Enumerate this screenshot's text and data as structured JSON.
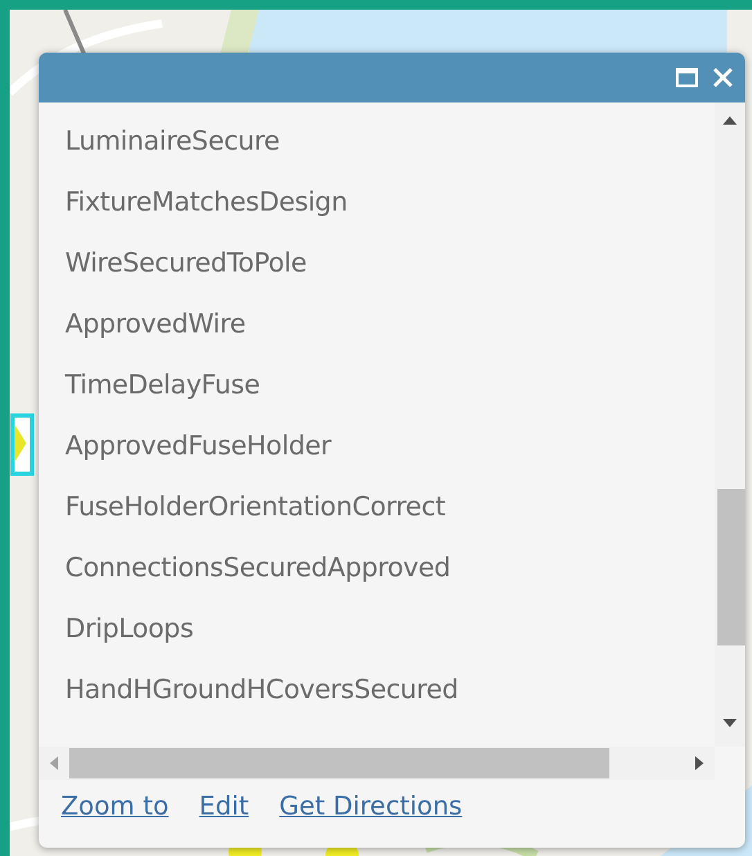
{
  "popup": {
    "controls": [
      {
        "kind": "maximize"
      },
      {
        "kind": "close"
      }
    ],
    "fields": [
      "LuminaireSecure",
      "FixtureMatchesDesign",
      "WireSecuredToPole",
      "ApprovedWire",
      "TimeDelayFuse",
      "ApprovedFuseHolder",
      "FuseHolderOrientationCorrect",
      "ConnectionsSecuredApproved",
      "DripLoops",
      "HandHGroundHCoversSecured"
    ],
    "actions": [
      "Zoom to",
      "Edit",
      "Get Directions"
    ]
  }
}
